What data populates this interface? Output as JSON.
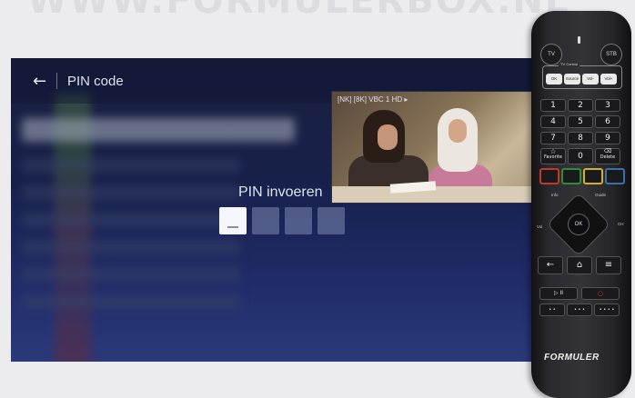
{
  "watermark": "WWW.FORMULERBOX.NL",
  "tv": {
    "back_icon": "arrow-left-icon",
    "title": "PIN code",
    "preview_label": "[NK] [8K] VBC 1 HD ▸",
    "pin_prompt": "PIN invoeren",
    "pin_digits": 4,
    "pin_active_index": 0
  },
  "remote": {
    "brand": "FORMULER",
    "power_tv": "TV",
    "power_stb": "STB",
    "tv_control_label": "TV Control",
    "tv_control_buttons": [
      "OK",
      "Source",
      "Vol-",
      "Vol+"
    ],
    "numbers": [
      "1",
      "2",
      "3",
      "4",
      "5",
      "6",
      "7",
      "8",
      "9"
    ],
    "favorite_label": "Favorite",
    "zero": "0",
    "delete_label": "Delete",
    "color_buttons": [
      "#c0392b",
      "#2e8b3a",
      "#d4b12a",
      "#3a6fb0"
    ],
    "info_label": "Info",
    "guide_label": "Guide",
    "vol_label": "Vol",
    "ch_label": "CH",
    "ok_label": "OK",
    "bottom_buttons": [
      "←",
      "⌂",
      "≡"
    ],
    "media_buttons": [
      "▷ II",
      "○"
    ],
    "extra_buttons": [
      "• •",
      "• • •",
      "• • • •"
    ]
  }
}
